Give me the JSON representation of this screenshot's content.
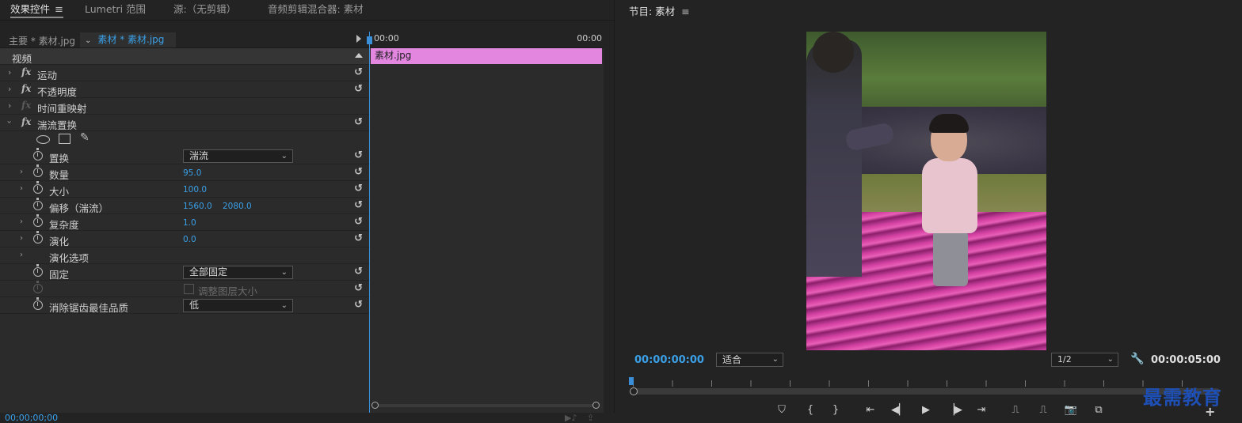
{
  "left_tabs": [
    "效果控件",
    "Lumetri 范围",
    "源:（无剪辑）",
    "音频剪辑混合器: 素材"
  ],
  "clipbar": {
    "master": "主要 * 素材.jpg",
    "sequence_clip": "素材 * 素材.jpg"
  },
  "section_video": "视频",
  "effects": {
    "motion": "运动",
    "opacity": "不透明度",
    "time_remap": "时间重映射",
    "turbulent": "湍流置换"
  },
  "params": {
    "displacement": {
      "label": "置换",
      "value": "湍流"
    },
    "amount": {
      "label": "数量",
      "value": "95.0"
    },
    "size": {
      "label": "大小",
      "value": "100.0"
    },
    "offset": {
      "label": "偏移（湍流）",
      "x": "1560.0",
      "y": "2080.0"
    },
    "complexity": {
      "label": "复杂度",
      "value": "1.0"
    },
    "evolution": {
      "label": "演化",
      "value": "0.0"
    },
    "evolution_options": {
      "label": "演化选项"
    },
    "pinning": {
      "label": "固定",
      "value": "全部固定"
    },
    "resize_layer": {
      "label": "调整图层大小"
    },
    "antialias": {
      "label": "消除锯齿最佳品质",
      "value": "低"
    }
  },
  "timeline": {
    "start": "00:00",
    "end": "00:00",
    "clip": "素材.jpg"
  },
  "ec_bottom": {
    "timecode": "00;00;00;00"
  },
  "program": {
    "title": "节目: 素材",
    "timecode_left": "00:00:00:00",
    "fit": "适合",
    "resolution": "1/2",
    "timecode_right": "00:00:05:00"
  },
  "watermark": "最需教育",
  "colors": {
    "accent_blue": "#3aa0e8",
    "clip_pink": "#e286e0",
    "panel_bg": "#2b2b2b"
  },
  "icons": [
    "menu-icon",
    "reset-icon",
    "stopwatch-icon",
    "ellipse-mask-icon",
    "rectangle-mask-icon",
    "pen-mask-icon",
    "wrench-icon",
    "marker-icon",
    "play-icon",
    "camera-icon"
  ]
}
